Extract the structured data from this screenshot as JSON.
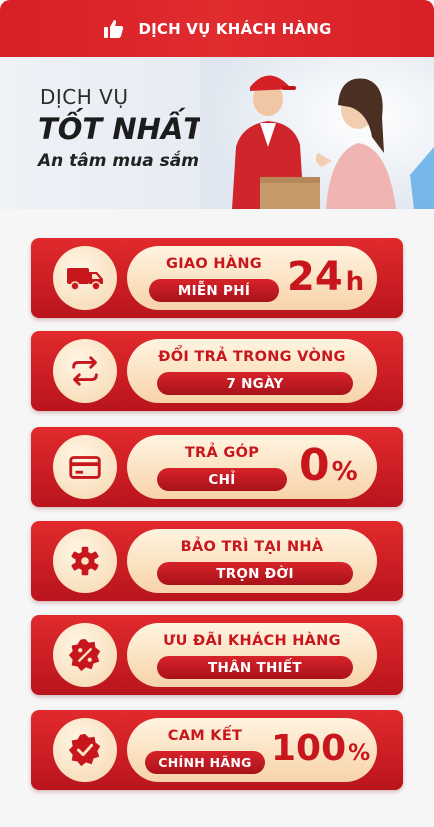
{
  "header": {
    "title": "DỊCH VỤ KHÁCH HÀNG",
    "icon": "thumbs-up-icon"
  },
  "banner": {
    "line1": "DỊCH VỤ",
    "line2": "TỐT NHẤT",
    "line3": "An tâm mua sắm"
  },
  "services": [
    {
      "icon": "truck-icon",
      "title": "GIAO HÀNG",
      "tag": "MIỄN PHÍ",
      "big": "24",
      "unit": "h"
    },
    {
      "icon": "exchange-arrows-icon",
      "title": "ĐỔI TRẢ TRONG VÒNG",
      "tag": "7 NGÀY"
    },
    {
      "icon": "credit-card-icon",
      "title": "TRẢ GÓP",
      "tag": "CHỈ",
      "big": "0",
      "unit": "%"
    },
    {
      "icon": "gear-icon",
      "title": "BẢO TRÌ TẠI NHÀ",
      "tag": "TRỌN ĐỜI"
    },
    {
      "icon": "discount-badge-icon",
      "title": "ƯU ĐÃI KHÁCH HÀNG",
      "tag": "THÂN THIẾT"
    },
    {
      "icon": "verified-badge-icon",
      "title": "CAM KẾT",
      "tag": "CHÍNH HÃNG",
      "big": "100",
      "unit": "%"
    }
  ],
  "colors": {
    "brand_red": "#d81f26",
    "pill_cream": "#fbe3c4",
    "text_red": "#c8161d"
  }
}
